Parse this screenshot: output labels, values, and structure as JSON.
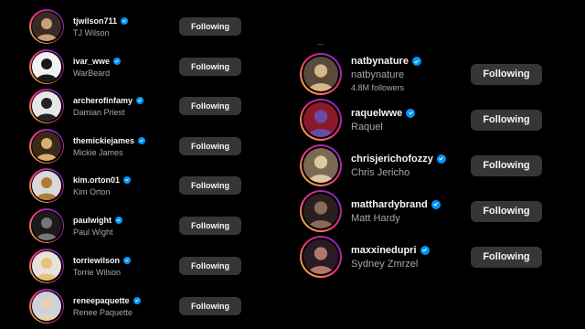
{
  "left_list": [
    {
      "username": "tjwilson711",
      "fullname": "TJ Wilson",
      "button": "Following",
      "avatar": {
        "bg": "#3a2a24",
        "fg": "#c9a07a"
      }
    },
    {
      "username": "ivar_wwe",
      "fullname": "WarBeard",
      "button": "Following",
      "avatar": {
        "bg": "#f2f2f2",
        "fg": "#1a1a1a"
      }
    },
    {
      "username": "archerofinfamy",
      "fullname": "Damian Priest",
      "button": "Following",
      "avatar": {
        "bg": "#e6e6e6",
        "fg": "#222222"
      }
    },
    {
      "username": "themickiejames",
      "fullname": "Mickie James",
      "button": "Following",
      "avatar": {
        "bg": "#3b2a1a",
        "fg": "#d9b070"
      }
    },
    {
      "username": "kim.orton01",
      "fullname": "Kim Orton",
      "button": "Following",
      "avatar": {
        "bg": "#d9d9d9",
        "fg": "#b07a3a"
      }
    },
    {
      "username": "paulwight",
      "fullname": "Paul Wight",
      "button": "Following",
      "avatar": {
        "bg": "#1a1a1a",
        "fg": "#777777"
      }
    },
    {
      "username": "torriewilson",
      "fullname": "Torrie Wilson",
      "button": "Following",
      "avatar": {
        "bg": "#e8e2dc",
        "fg": "#e6c27a"
      }
    },
    {
      "username": "reneepaquette",
      "fullname": "Renee Paquette",
      "button": "Following",
      "avatar": {
        "bg": "#cfd3d9",
        "fg": "#e8d2b0"
      }
    }
  ],
  "right_list": [
    {
      "username": "natbynature",
      "fullname": "natbynature",
      "followers": "4.8M followers",
      "button": "Following",
      "avatar": {
        "bg": "#5a4a3c",
        "fg": "#d8b58a"
      }
    },
    {
      "username": "raquelwwe",
      "fullname": "Raquel",
      "button": "Following",
      "avatar": {
        "bg": "#8a1a2a",
        "fg": "#6a4aa8"
      }
    },
    {
      "username": "chrisjerichofozzy",
      "fullname": "Chris Jericho",
      "button": "Following",
      "avatar": {
        "bg": "#7a6a55",
        "fg": "#e0c8a0"
      }
    },
    {
      "username": "matthardybrand",
      "fullname": "Matt Hardy",
      "button": "Following",
      "avatar": {
        "bg": "#2a1e1e",
        "fg": "#8a6a5a"
      }
    },
    {
      "username": "maxxinedupri",
      "fullname": "Sydney Zmrzel",
      "button": "Following",
      "avatar": {
        "bg": "#2a1a24",
        "fg": "#b07a6a"
      }
    }
  ],
  "icons": {
    "verified": "verified-badge-icon",
    "avatar": "profile-avatar"
  },
  "colors": {
    "verified": "#0095f6",
    "button_bg": "#363636",
    "ring_start": "#f9ce34",
    "ring_mid": "#ee2a7b",
    "ring_end": "#6228d7"
  }
}
